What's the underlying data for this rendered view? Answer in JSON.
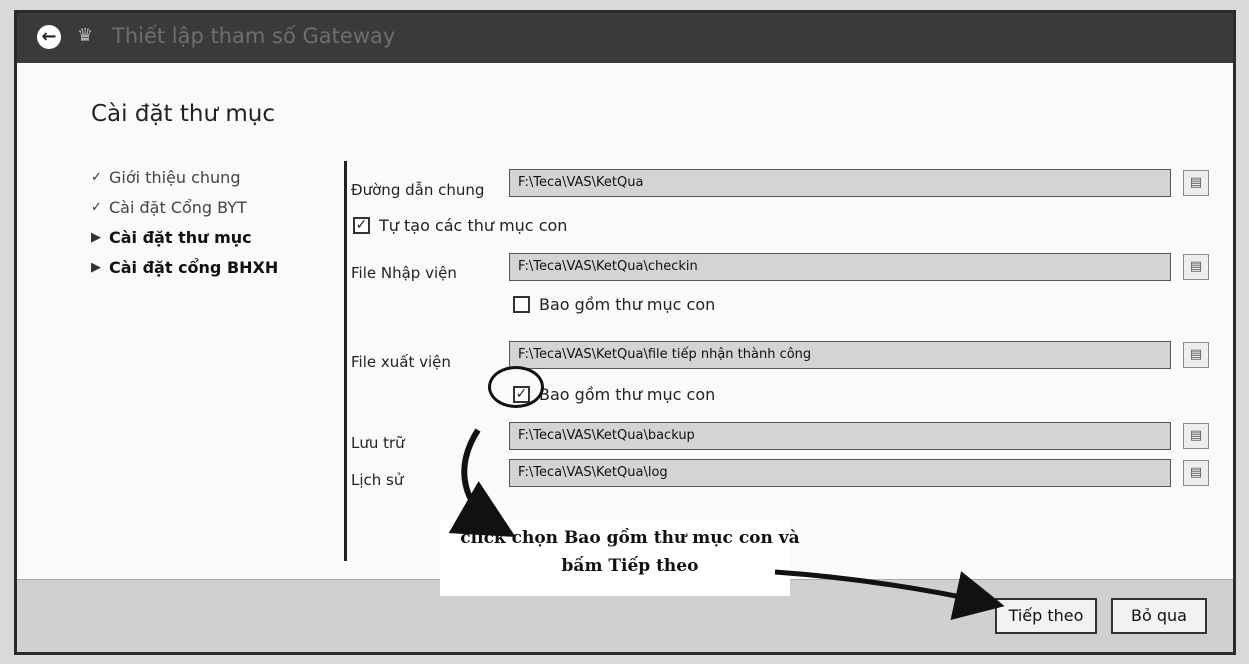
{
  "titlebar": {
    "title": "Thiết lập tham số Gateway"
  },
  "page_title": "Cài đặt thư mục",
  "steps": [
    {
      "label": "Giới thiệu chung",
      "state": "done"
    },
    {
      "label": "Cài đặt Cổng BYT",
      "state": "done"
    },
    {
      "label": "Cài đặt thư mục",
      "state": "current"
    },
    {
      "label": "Cài đặt cổng BHXH",
      "state": "pending"
    }
  ],
  "fields": {
    "common_path": {
      "label": "Đường dẫn chung",
      "value": "F:\\Teca\\VAS\\KetQua"
    },
    "auto_create": {
      "label": "Tự tạo các thư mục con",
      "checked": true
    },
    "admission": {
      "label": "File Nhập viện",
      "value": "F:\\Teca\\VAS\\KetQua\\checkin"
    },
    "admission_include": {
      "label": "Bao gồm thư mục con",
      "checked": false
    },
    "discharge": {
      "label": "File xuất viện",
      "value": "F:\\Teca\\VAS\\KetQua\\file tiếp nhận thành công"
    },
    "discharge_include": {
      "label": "Bao gồm thư mục con",
      "checked": true
    },
    "archive": {
      "label": "Lưu trữ",
      "value": "F:\\Teca\\VAS\\KetQua\\backup"
    },
    "history": {
      "label": "Lịch sử",
      "value": "F:\\Teca\\VAS\\KetQua\\log"
    }
  },
  "annotation": {
    "line1": "click chọn Bao gồm thư mục con và",
    "line2": "bấm Tiếp theo"
  },
  "buttons": {
    "next": "Tiếp theo",
    "skip": "Bỏ qua"
  },
  "icons": {
    "check_mark": "✓",
    "arrow_bullet": "▶",
    "checkbox_tick": "✓",
    "back": "←",
    "folder": "▤"
  }
}
